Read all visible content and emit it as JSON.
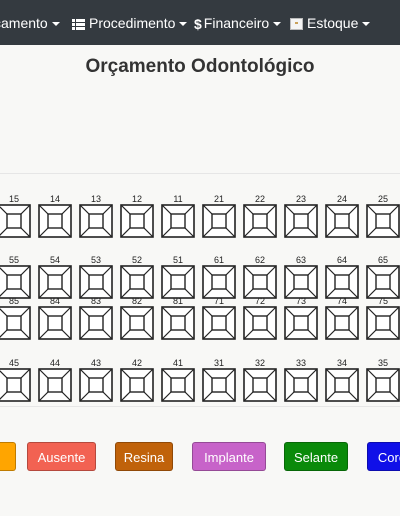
{
  "navbar": {
    "items": [
      {
        "label": "çamento",
        "icon": "caret"
      },
      {
        "label": "Procedimento",
        "icon": "list-icon"
      },
      {
        "label": "Financeiro",
        "icon": "dollar-icon"
      },
      {
        "label": "Estoque",
        "icon": "box-icon"
      }
    ]
  },
  "page": {
    "title": "Orçamento Odontológico"
  },
  "teeth": {
    "row1": [
      "15",
      "14",
      "13",
      "12",
      "11",
      "21",
      "22",
      "23",
      "24",
      "25"
    ],
    "row2": [
      "55",
      "54",
      "53",
      "52",
      "51",
      "61",
      "62",
      "63",
      "64",
      "65"
    ],
    "row3": [
      "85",
      "84",
      "83",
      "82",
      "81",
      "71",
      "72",
      "73",
      "74",
      "75"
    ],
    "row4": [
      "45",
      "44",
      "43",
      "42",
      "41",
      "31",
      "32",
      "33",
      "34",
      "35"
    ]
  },
  "legend": {
    "buttons": [
      {
        "label": "",
        "color": "#ffa500"
      },
      {
        "label": "Ausente",
        "color": "#f26252"
      },
      {
        "label": "Resina",
        "color": "#c0620a"
      },
      {
        "label": "Implante",
        "color": "#c763c9"
      },
      {
        "label": "Selante",
        "color": "#0a8a0a"
      },
      {
        "label": "Coro",
        "color": "#1010e8"
      }
    ]
  }
}
